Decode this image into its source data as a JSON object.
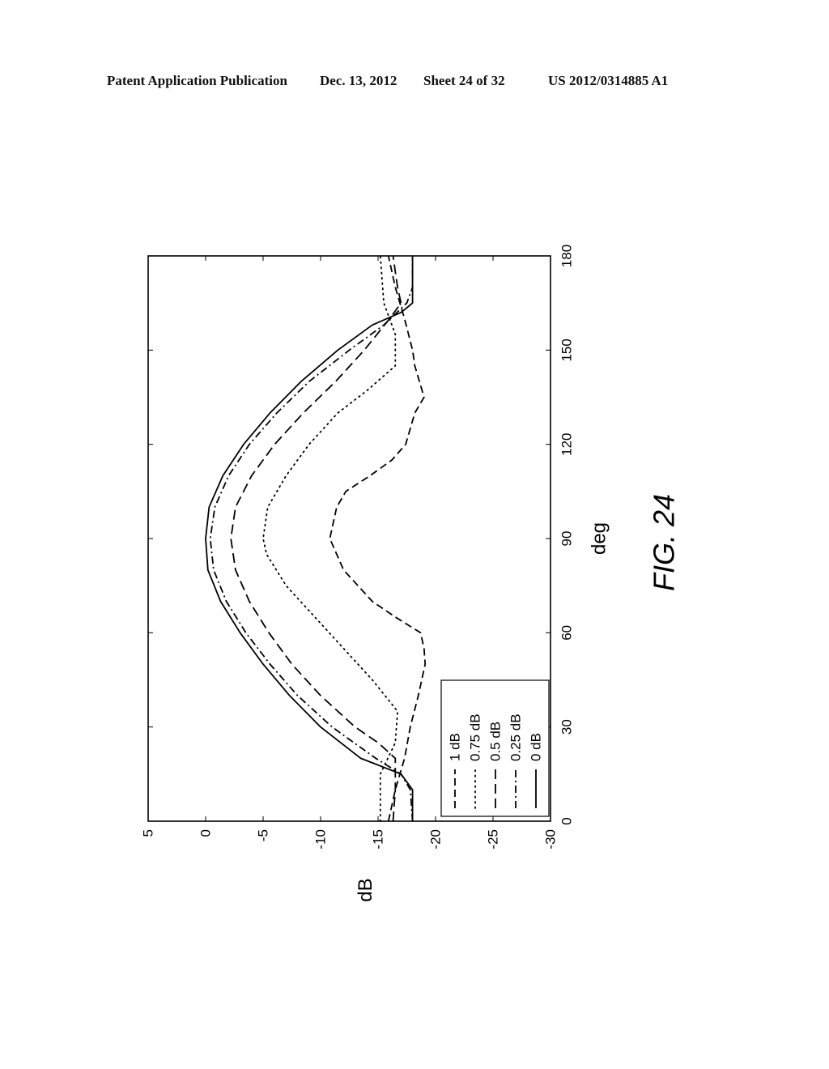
{
  "header": {
    "publication": "Patent Application Publication",
    "date": "Dec. 13, 2012",
    "sheet": "Sheet 24 of 32",
    "number": "US 2012/0314885 A1"
  },
  "figure_label": "FIG. 24",
  "chart_data": {
    "type": "line",
    "title": "",
    "orientation": "rotated 90 degrees counter-clockwise",
    "xlabel": "deg",
    "ylabel": "dB",
    "xlim": [
      0,
      180
    ],
    "ylim": [
      -30,
      5
    ],
    "xticks": [
      0,
      30,
      60,
      90,
      120,
      150,
      180
    ],
    "yticks": [
      5,
      0,
      -5,
      -10,
      -15,
      -20,
      -25,
      -30
    ],
    "xtick_labels": [
      "0",
      "30",
      "60",
      "90",
      "120",
      "150",
      "180"
    ],
    "ytick_labels": [
      "5",
      "0",
      "-5",
      "-10",
      "-15",
      "-20",
      "-25",
      "-30"
    ],
    "grid": false,
    "legend_position": "lower-left (in rotated view)",
    "series": [
      {
        "name": "1 dB",
        "style": "dashed",
        "x": [
          0,
          10,
          20,
          30,
          40,
          50,
          55,
          60,
          65,
          70,
          80,
          90,
          100,
          105,
          110,
          115,
          120,
          130,
          135,
          140,
          145,
          150,
          160,
          170,
          180
        ],
        "y": [
          -15.9,
          -16.5,
          -17.3,
          -17.8,
          -18.5,
          -19.1,
          -19.0,
          -18.7,
          -16.5,
          -14.5,
          -12.0,
          -10.8,
          -11.4,
          -12.2,
          -14.3,
          -16.2,
          -17.4,
          -18.2,
          -19.0,
          -18.6,
          -18.2,
          -18.0,
          -17.3,
          -16.5,
          -15.9
        ]
      },
      {
        "name": "0.75 dB",
        "style": "dotted",
        "x": [
          0,
          15,
          25,
          35,
          45,
          55,
          65,
          75,
          85,
          90,
          100,
          110,
          120,
          130,
          137,
          145,
          155,
          165,
          180
        ],
        "y": [
          -15.2,
          -15.2,
          -16.5,
          -16.7,
          -14.5,
          -12.0,
          -9.5,
          -7.0,
          -5.3,
          -5.0,
          -5.4,
          -7.0,
          -9.0,
          -11.5,
          -14.0,
          -16.5,
          -16.5,
          -15.5,
          -15.2
        ]
      },
      {
        "name": "0.5 dB",
        "style": "long-dashed",
        "x": [
          0,
          10,
          20,
          25,
          30,
          40,
          50,
          60,
          70,
          80,
          90,
          100,
          110,
          120,
          130,
          140,
          150,
          160,
          165,
          170,
          180
        ],
        "y": [
          -16.3,
          -16.5,
          -16.5,
          -15.0,
          -13.0,
          -10.0,
          -7.5,
          -5.5,
          -3.8,
          -2.6,
          -2.2,
          -2.6,
          -4.0,
          -6.0,
          -8.5,
          -11.3,
          -13.8,
          -16.0,
          -17.0,
          -16.7,
          -16.3
        ]
      },
      {
        "name": "0.25 dB",
        "style": "dash-dot",
        "x": [
          0,
          10,
          15,
          20,
          30,
          40,
          50,
          60,
          70,
          80,
          90,
          100,
          110,
          120,
          130,
          140,
          150,
          158,
          165,
          170,
          180
        ],
        "y": [
          -18.0,
          -17.8,
          -17.0,
          -14.8,
          -11.0,
          -8.0,
          -5.6,
          -3.5,
          -1.8,
          -0.7,
          -0.4,
          -0.8,
          -2.0,
          -3.8,
          -6.2,
          -9.0,
          -12.5,
          -15.5,
          -17.5,
          -18.0,
          -18.0
        ]
      },
      {
        "name": "0 dB",
        "style": "solid",
        "x": [
          0,
          10,
          15,
          20,
          30,
          40,
          50,
          60,
          70,
          80,
          90,
          100,
          110,
          120,
          130,
          140,
          150,
          158,
          162,
          165,
          170,
          180
        ],
        "y": [
          -18.0,
          -18.0,
          -17.0,
          -13.5,
          -10.0,
          -7.3,
          -5.0,
          -3.0,
          -1.3,
          -0.2,
          0.0,
          -0.3,
          -1.5,
          -3.3,
          -5.6,
          -8.3,
          -11.5,
          -14.5,
          -17.0,
          -18.0,
          -18.0,
          -18.0
        ]
      }
    ]
  }
}
